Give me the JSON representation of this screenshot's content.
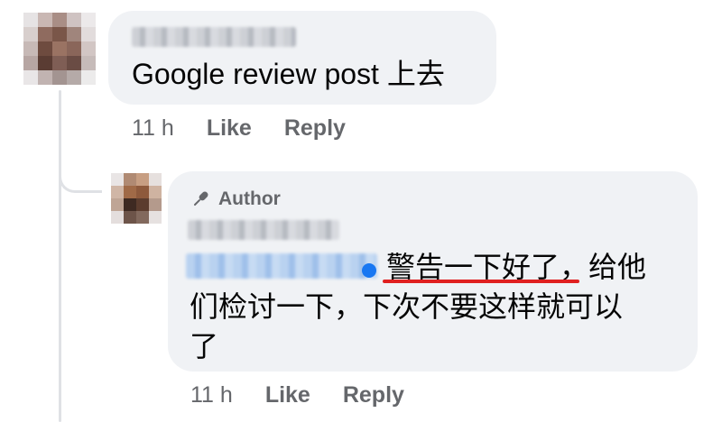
{
  "comments": [
    {
      "text": "Google review post 上去",
      "time": "11 h",
      "like_label": "Like",
      "reply_label": "Reply"
    }
  ],
  "reply": {
    "badge_label": "Author",
    "badge_icon": "microphone-icon",
    "text_line_1": "警告一下好了，给他",
    "text_line_2": "们检讨一下，下次不要这样就可以",
    "text_line_3": "了",
    "time": "11 h",
    "like_label": "Like",
    "reply_label": "Reply"
  },
  "colors": {
    "bubble": "#f0f2f5",
    "secondary_text": "#65676b",
    "underline": "#e02020",
    "thread_line": "#dfe1e5"
  }
}
